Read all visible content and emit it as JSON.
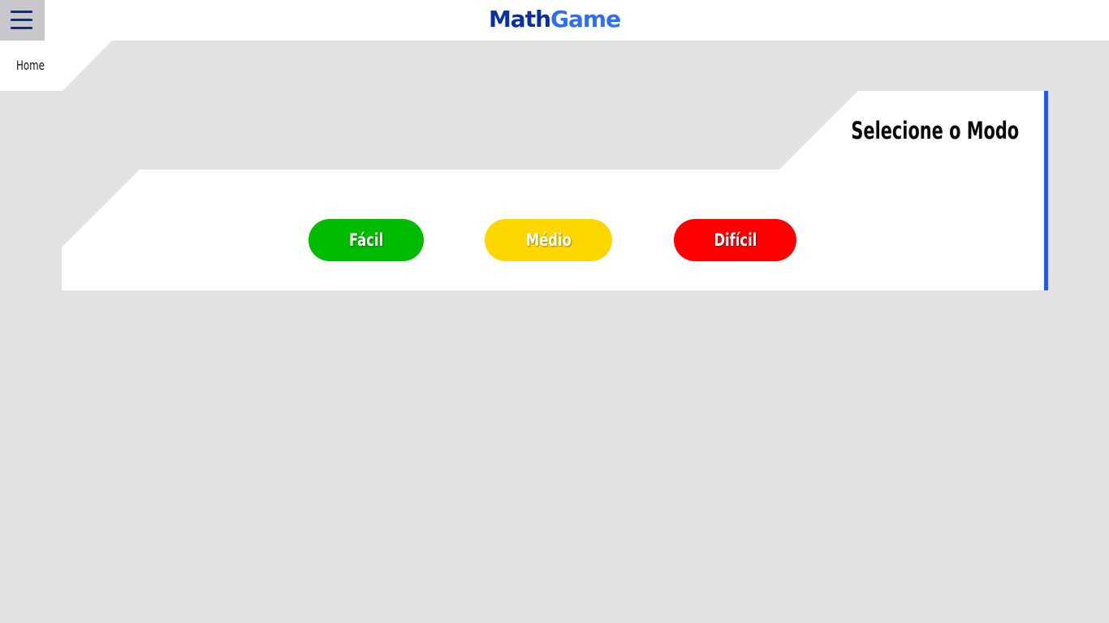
{
  "header": {
    "menu_icon": "hamburger-menu-icon",
    "logo_part1": "Math",
    "logo_part2": "Game",
    "colors": {
      "logo_dark": "#0a2fa0",
      "logo_light": "#2f6df5"
    }
  },
  "breadcrumb": {
    "home_label": "Home"
  },
  "panel": {
    "title": "Selecione o Modo",
    "accent_color": "#1c5cf2",
    "modes": [
      {
        "label": "Fácil",
        "color": "#00bb00"
      },
      {
        "label": "Médio",
        "color": "#ffd700"
      },
      {
        "label": "Difícil",
        "color": "#ff0000"
      }
    ]
  },
  "page_background": "#e2e2e2"
}
